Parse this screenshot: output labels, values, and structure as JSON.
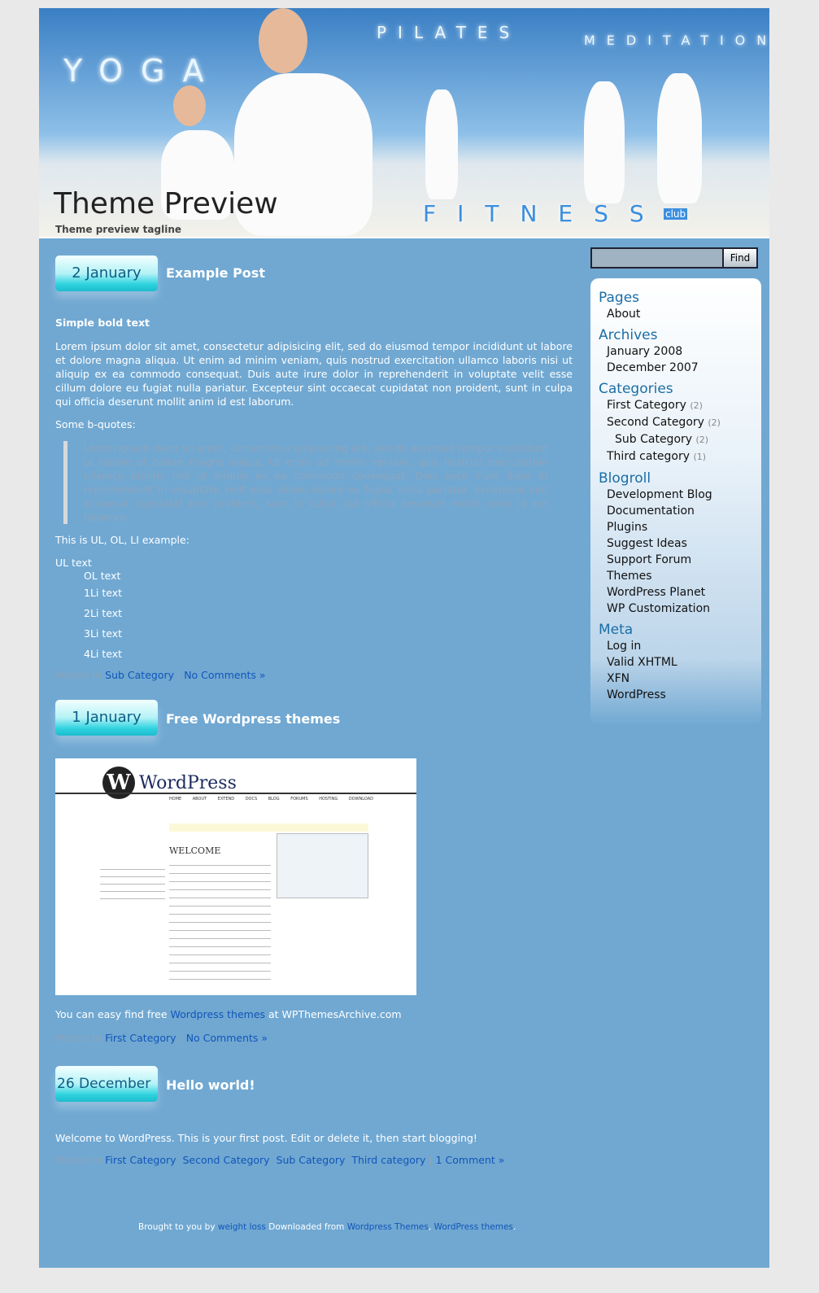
{
  "header": {
    "title": "Theme Preview",
    "tagline": "Theme preview tagline",
    "words": [
      "YOGA",
      "PILATES",
      "MEDITATION",
      "FITNESS",
      "club"
    ]
  },
  "search": {
    "value": "",
    "button": "Find"
  },
  "posts": [
    {
      "date": "2 January",
      "title": "Example Post",
      "bold": "Simple bold text",
      "para": "Lorem ipsum dolor sit amet, consectetur adipisicing elit, sed do eiusmod tempor incididunt ut labore et dolore magna aliqua. Ut enim ad minim veniam, quis nostrud exercitation ullamco laboris nisi ut aliquip ex ea commodo consequat. Duis aute irure dolor in reprehenderit in voluptate velit esse cillum dolore eu fugiat nulla pariatur. Excepteur sint occaecat cupidatat non proident, sunt in culpa qui officia deserunt mollit anim id est laborum.",
      "bq_label": "Some b-quotes:",
      "quote": "Lorem ipsum dolor sit amet, consectetur adipisicing elit, sed do eiusmod tempor incididunt ut labore et dolore magna aliqua. Ut enim ad minim veniam, quis nostrud exercitation ullamco laboris nisi ut aliquip ex ea commodo consequat. Duis aute irure dolor in reprehenderit in voluptate velit esse cillum dolore eu fugiat nulla pariatur. Excepteur sint occaecat cupidatat non proident, sunt in culpa qui officia deserunt mollit anim id est laborum.",
      "list_label": "This is UL, OL, LI example:",
      "ul": "UL text",
      "ol": "OL text",
      "items": [
        "1Li text",
        "2Li text",
        "3Li text",
        "4Li text"
      ],
      "posted": "Posted in",
      "cats": [
        "Sub Category"
      ],
      "comments": "No Comments »"
    },
    {
      "date": "1 January",
      "title": "Free Wordpress themes",
      "text_pre": "You can easy find free",
      "link": "Wordpress themes",
      "text_post": "at WPThemesArchive.com",
      "posted": "Posted in",
      "cats": [
        "First Category"
      ],
      "comments": "No Comments »",
      "shot": {
        "logo": "WordPress",
        "welcome": "WELCOME",
        "nav": [
          "HOME",
          "ABOUT",
          "EXTEND",
          "DOCS",
          "BLOG",
          "FORUMS",
          "HOSTING",
          "DOWNLOAD"
        ]
      }
    },
    {
      "date": "26 December",
      "title": "Hello world!",
      "text": "Welcome to WordPress. This is your first post. Edit or delete it, then start blogging!",
      "posted": "Posted in",
      "cats": [
        "First Category",
        "Second Category",
        "Sub Category",
        "Third category"
      ],
      "comments": "1 Comment »"
    }
  ],
  "sidebar": {
    "pages": {
      "title": "Pages",
      "items": [
        "About"
      ]
    },
    "archives": {
      "title": "Archives",
      "items": [
        "January 2008",
        "December 2007"
      ]
    },
    "categories": {
      "title": "Categories",
      "items": [
        {
          "name": "First Category",
          "count": "(2)"
        },
        {
          "name": "Second Category",
          "count": "(2)"
        },
        {
          "name": "Sub Category",
          "count": "(2)"
        },
        {
          "name": "Third category",
          "count": "(1)"
        }
      ]
    },
    "blogroll": {
      "title": "Blogroll",
      "items": [
        "Development Blog",
        "Documentation",
        "Plugins",
        "Suggest Ideas",
        "Support Forum",
        "Themes",
        "WordPress Planet",
        "WP Customization"
      ]
    },
    "meta": {
      "title": "Meta",
      "items": [
        "Log in",
        "Valid XHTML",
        "XFN",
        "WordPress"
      ]
    }
  },
  "footer": {
    "pre": "Brought to you by",
    "l1": "weight loss",
    "mid": "Downloaded from",
    "l2": "Wordpress Themes",
    "l3": "WordPress themes"
  }
}
